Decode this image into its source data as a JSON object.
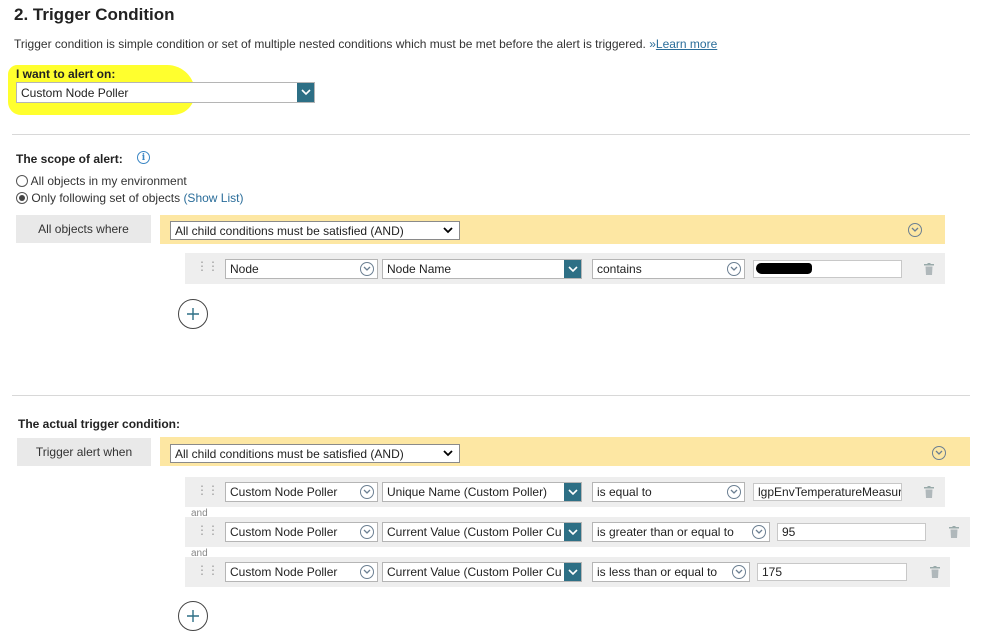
{
  "section_title": "2. Trigger Condition",
  "description": "Trigger condition is simple condition or set of multiple nested conditions which must be met before the alert is triggered.",
  "learn_more_prefix": "»",
  "learn_more": "Learn more",
  "alert_on": {
    "label": "I want to alert on:",
    "value": "Custom Node Poller"
  },
  "scope": {
    "label": "The scope of alert:",
    "info_icon": "i",
    "options": [
      {
        "label": "All objects in my environment",
        "selected": false
      },
      {
        "label": "Only following set of objects",
        "selected": true
      }
    ],
    "show_list": "(Show List)",
    "group_label": "All objects where",
    "group_operator": "All child conditions must be satisfied (AND)",
    "conditions": [
      {
        "object": "Node",
        "field": "Node Name",
        "operator": "contains",
        "value": ""
      }
    ]
  },
  "trigger": {
    "label": "The actual trigger condition:",
    "group_label": "Trigger alert when",
    "group_operator": "All child conditions must be satisfied (AND)",
    "joiner": "and",
    "conditions": [
      {
        "object": "Custom Node Poller",
        "field": "Unique Name (Custom Poller)",
        "operator": "is equal to",
        "value": "lgpEnvTemperatureMeasure"
      },
      {
        "object": "Custom Node Poller",
        "field": "Current Value (Custom Poller Cu",
        "operator": "is greater than or equal to",
        "value": "95"
      },
      {
        "object": "Custom Node Poller",
        "field": "Current Value (Custom Poller Cu",
        "operator": "is less than or equal to",
        "value": "175"
      }
    ]
  },
  "colors": {
    "accent": "#2d6f85",
    "group_bar": "#fde7a3",
    "highlight": "#ffff2e",
    "link": "#2a6d9a"
  }
}
